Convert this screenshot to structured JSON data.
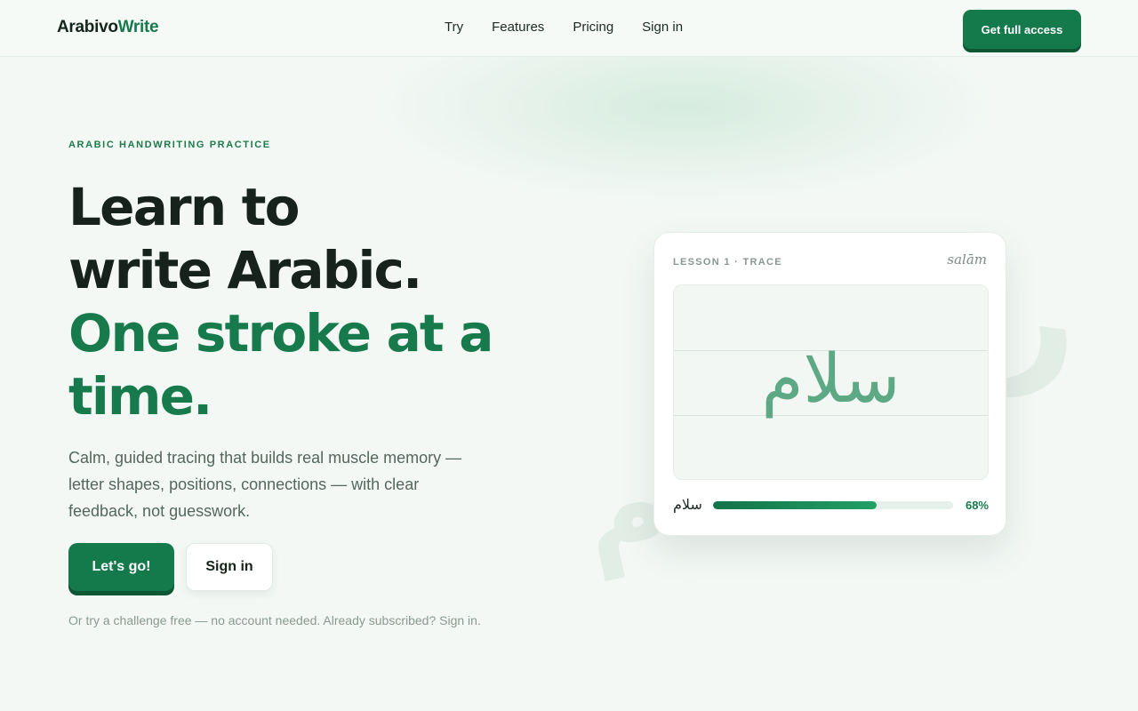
{
  "brand": {
    "name_part1": "Arabivo",
    "name_part2": "Write"
  },
  "nav": {
    "items": [
      "Try",
      "Features",
      "Pricing",
      "Sign in"
    ]
  },
  "header": {
    "cta_label": "Get full access"
  },
  "hero": {
    "eyebrow": "ARABIC HANDWRITING PRACTICE",
    "headline_line1": "Learn to",
    "headline_line2": "write Arabic.",
    "headline_accent_line1": "One stroke at a",
    "headline_accent_line2": "time.",
    "lede": "Calm, guided tracing that builds real muscle memory — letter shapes, positions, connections — with clear feedback, not guesswork.",
    "primary_button": "Let's go!",
    "secondary_button": "Sign in",
    "note": "Or try a challenge free — no account needed. Already subscribed? Sign in."
  },
  "card": {
    "tag": "LESSON 1 · TRACE",
    "transliteration": "salām",
    "word": "سلام",
    "word_small": "سلام",
    "progress": 0.68,
    "progress_label": "68%"
  },
  "decor": {
    "glyph_left": "م",
    "glyph_right": "ر"
  },
  "colors": {
    "accent": "#157a4b",
    "background": "#f3f8f5",
    "trace": "#5ea985"
  }
}
